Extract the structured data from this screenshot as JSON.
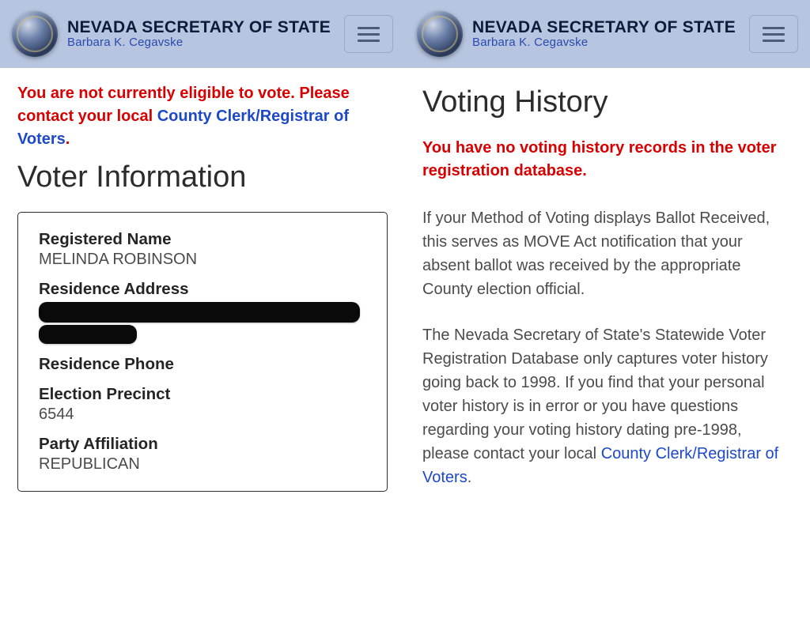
{
  "header": {
    "title": "NEVADA SECRETARY OF STATE",
    "subtitle": "Barbara K. Cegavske"
  },
  "left": {
    "alert_prefix": "You are not currently eligible to vote. Please contact your local ",
    "alert_link": "County Clerk/Registrar of Voters",
    "alert_suffix": ".",
    "section_title": "Voter Information",
    "fields": {
      "name_label": "Registered Name",
      "name_value": "MELINDA ROBINSON",
      "address_label": "Residence Address",
      "phone_label": "Residence Phone",
      "phone_value": "",
      "precinct_label": "Election Precinct",
      "precinct_value": "6544",
      "party_label": "Party Affiliation",
      "party_value": "REPUBLICAN"
    }
  },
  "right": {
    "section_title": "Voting History",
    "alert": "You have no voting history records in the voter registration database.",
    "para1": "If your Method of Voting displays Ballot Received, this serves as MOVE Act notification that your absent ballot was received by the appropriate County election official.",
    "para2_prefix": "The Nevada Secretary of State's Statewide Voter Registration Database only captures voter history going back to 1998. If you find that your personal voter history is in error or you have questions regarding your voting history dating pre-1998, please contact your local ",
    "para2_link": "County Clerk/Registrar of Voters",
    "para2_suffix": "."
  }
}
